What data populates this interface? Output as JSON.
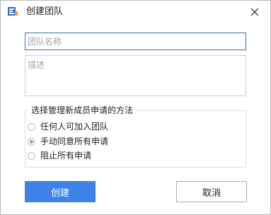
{
  "window": {
    "title": "创建团队",
    "app_icon": "team-app-icon",
    "close_icon": "close-icon"
  },
  "form": {
    "name_placeholder": "团队名称",
    "name_value": "",
    "description_placeholder": "描述",
    "description_value": ""
  },
  "join_method": {
    "legend": "选择管理新成员申请的方法",
    "options": [
      {
        "label": "任何人可加入团队",
        "checked": false
      },
      {
        "label": "手动同意所有申请",
        "checked": true
      },
      {
        "label": "阻止所有申请",
        "checked": false
      }
    ]
  },
  "buttons": {
    "create_label": "创建",
    "cancel_label": "取消"
  },
  "colors": {
    "primary": "#3c82e8",
    "focus_border": "#3c6fb8",
    "app_icon_blue": "#2b6cc4",
    "app_icon_orange": "#f29a1c"
  }
}
